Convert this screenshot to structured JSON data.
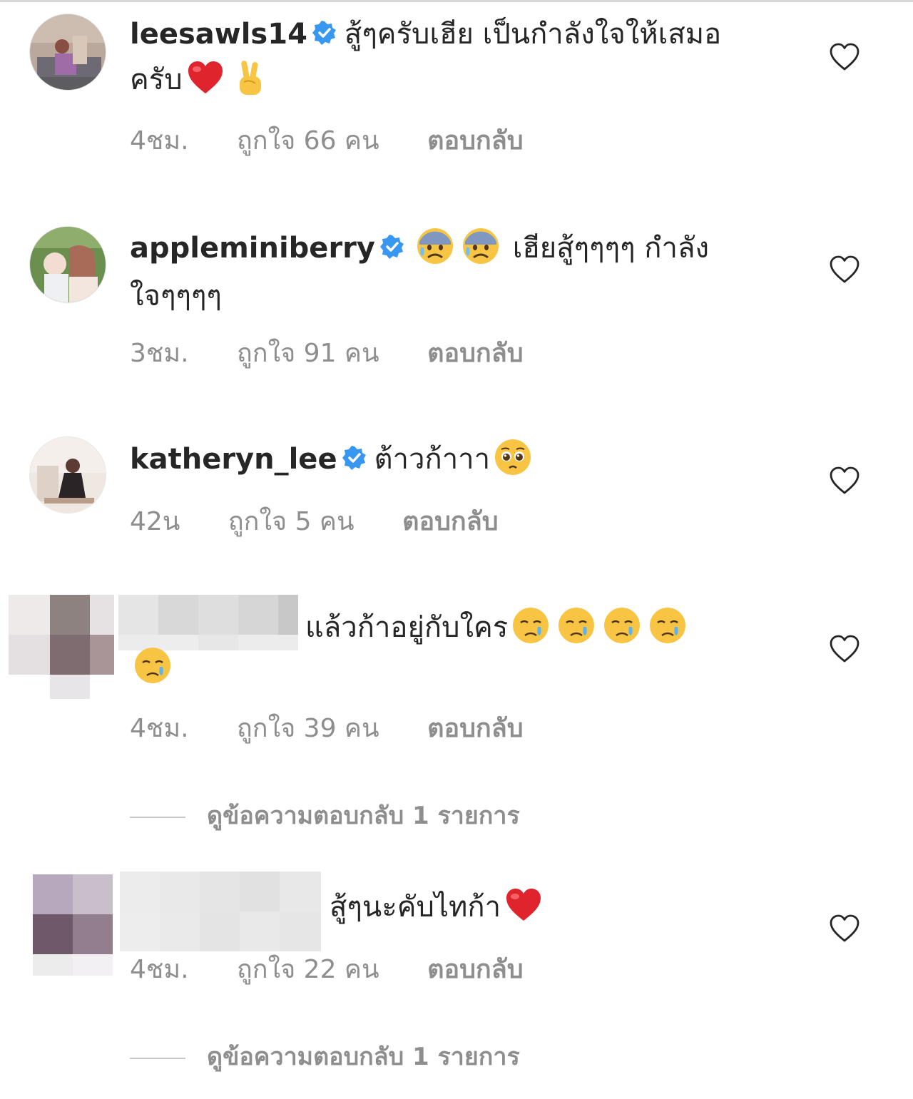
{
  "comments": [
    {
      "username": "leesawls14",
      "verified": true,
      "text": "สู้ๆครับเฮีย เป็นกำลังใจให้เสมอครับ",
      "emojis_after": [
        "red-heart",
        "victory-hand"
      ],
      "time": "4ชม.",
      "likes": "ถูกใจ 66 คน",
      "reply_label": "ตอบกลับ"
    },
    {
      "username": "appleminiberry",
      "verified": true,
      "emojis_before": [
        "anxious-face-with-sweat",
        "anxious-face-with-sweat"
      ],
      "text": "เฮียสู้ๆๆๆๆ กำลังใจๆๆๆๆ",
      "time": "3ชม.",
      "likes": "ถูกใจ 91 คน",
      "reply_label": "ตอบกลับ"
    },
    {
      "username": "katheryn_lee",
      "verified": true,
      "text": "ต้าวก้าาา",
      "emojis_after": [
        "pleading-face"
      ],
      "time": "42น",
      "likes": "ถูกใจ 5 คน",
      "reply_label": "ตอบกลับ"
    },
    {
      "username_hidden": true,
      "text": "แล้วก้าอยู่กับใคร",
      "emojis_after": [
        "crying-face",
        "crying-face",
        "crying-face",
        "crying-face",
        "crying-face"
      ],
      "time": "4ชม.",
      "likes": "ถูกใจ 39 คน",
      "reply_label": "ตอบกลับ",
      "view_replies": "ดูข้อความตอบกลับ 1 รายการ"
    },
    {
      "username_hidden": true,
      "text": "สู้ๆนะคับไทก้า",
      "emojis_after": [
        "red-heart"
      ],
      "time": "4ชม.",
      "likes": "ถูกใจ 22 คน",
      "reply_label": "ตอบกลับ",
      "view_replies": "ดูข้อความตอบกลับ 1 รายการ"
    }
  ],
  "colors": {
    "text": "#262626",
    "meta": "#8e8e8e",
    "verified": "#3897f0",
    "heart_outline": "#262626"
  },
  "icons": [
    "verified-badge-icon",
    "heart-outline-icon"
  ]
}
